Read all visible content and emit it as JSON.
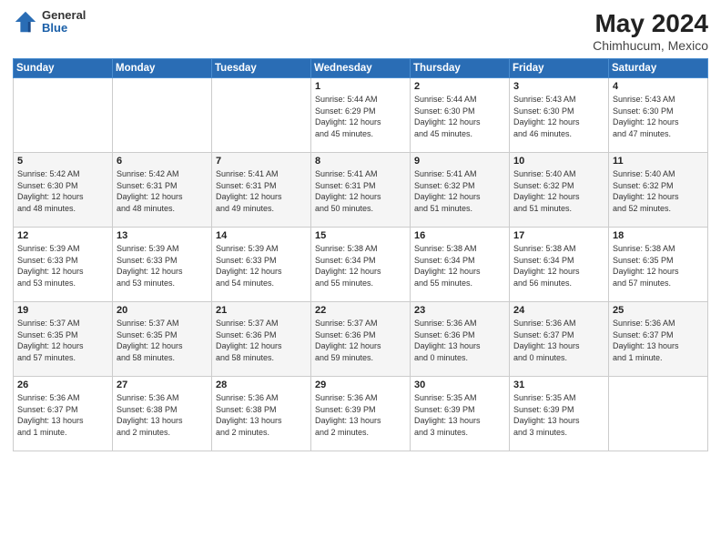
{
  "header": {
    "logo_general": "General",
    "logo_blue": "Blue",
    "month_year": "May 2024",
    "location": "Chimhucum, Mexico"
  },
  "weekdays": [
    "Sunday",
    "Monday",
    "Tuesday",
    "Wednesday",
    "Thursday",
    "Friday",
    "Saturday"
  ],
  "weeks": [
    [
      {
        "day": "",
        "info": ""
      },
      {
        "day": "",
        "info": ""
      },
      {
        "day": "",
        "info": ""
      },
      {
        "day": "1",
        "info": "Sunrise: 5:44 AM\nSunset: 6:29 PM\nDaylight: 12 hours\nand 45 minutes."
      },
      {
        "day": "2",
        "info": "Sunrise: 5:44 AM\nSunset: 6:30 PM\nDaylight: 12 hours\nand 45 minutes."
      },
      {
        "day": "3",
        "info": "Sunrise: 5:43 AM\nSunset: 6:30 PM\nDaylight: 12 hours\nand 46 minutes."
      },
      {
        "day": "4",
        "info": "Sunrise: 5:43 AM\nSunset: 6:30 PM\nDaylight: 12 hours\nand 47 minutes."
      }
    ],
    [
      {
        "day": "5",
        "info": "Sunrise: 5:42 AM\nSunset: 6:30 PM\nDaylight: 12 hours\nand 48 minutes."
      },
      {
        "day": "6",
        "info": "Sunrise: 5:42 AM\nSunset: 6:31 PM\nDaylight: 12 hours\nand 48 minutes."
      },
      {
        "day": "7",
        "info": "Sunrise: 5:41 AM\nSunset: 6:31 PM\nDaylight: 12 hours\nand 49 minutes."
      },
      {
        "day": "8",
        "info": "Sunrise: 5:41 AM\nSunset: 6:31 PM\nDaylight: 12 hours\nand 50 minutes."
      },
      {
        "day": "9",
        "info": "Sunrise: 5:41 AM\nSunset: 6:32 PM\nDaylight: 12 hours\nand 51 minutes."
      },
      {
        "day": "10",
        "info": "Sunrise: 5:40 AM\nSunset: 6:32 PM\nDaylight: 12 hours\nand 51 minutes."
      },
      {
        "day": "11",
        "info": "Sunrise: 5:40 AM\nSunset: 6:32 PM\nDaylight: 12 hours\nand 52 minutes."
      }
    ],
    [
      {
        "day": "12",
        "info": "Sunrise: 5:39 AM\nSunset: 6:33 PM\nDaylight: 12 hours\nand 53 minutes."
      },
      {
        "day": "13",
        "info": "Sunrise: 5:39 AM\nSunset: 6:33 PM\nDaylight: 12 hours\nand 53 minutes."
      },
      {
        "day": "14",
        "info": "Sunrise: 5:39 AM\nSunset: 6:33 PM\nDaylight: 12 hours\nand 54 minutes."
      },
      {
        "day": "15",
        "info": "Sunrise: 5:38 AM\nSunset: 6:34 PM\nDaylight: 12 hours\nand 55 minutes."
      },
      {
        "day": "16",
        "info": "Sunrise: 5:38 AM\nSunset: 6:34 PM\nDaylight: 12 hours\nand 55 minutes."
      },
      {
        "day": "17",
        "info": "Sunrise: 5:38 AM\nSunset: 6:34 PM\nDaylight: 12 hours\nand 56 minutes."
      },
      {
        "day": "18",
        "info": "Sunrise: 5:38 AM\nSunset: 6:35 PM\nDaylight: 12 hours\nand 57 minutes."
      }
    ],
    [
      {
        "day": "19",
        "info": "Sunrise: 5:37 AM\nSunset: 6:35 PM\nDaylight: 12 hours\nand 57 minutes."
      },
      {
        "day": "20",
        "info": "Sunrise: 5:37 AM\nSunset: 6:35 PM\nDaylight: 12 hours\nand 58 minutes."
      },
      {
        "day": "21",
        "info": "Sunrise: 5:37 AM\nSunset: 6:36 PM\nDaylight: 12 hours\nand 58 minutes."
      },
      {
        "day": "22",
        "info": "Sunrise: 5:37 AM\nSunset: 6:36 PM\nDaylight: 12 hours\nand 59 minutes."
      },
      {
        "day": "23",
        "info": "Sunrise: 5:36 AM\nSunset: 6:36 PM\nDaylight: 13 hours\nand 0 minutes."
      },
      {
        "day": "24",
        "info": "Sunrise: 5:36 AM\nSunset: 6:37 PM\nDaylight: 13 hours\nand 0 minutes."
      },
      {
        "day": "25",
        "info": "Sunrise: 5:36 AM\nSunset: 6:37 PM\nDaylight: 13 hours\nand 1 minute."
      }
    ],
    [
      {
        "day": "26",
        "info": "Sunrise: 5:36 AM\nSunset: 6:37 PM\nDaylight: 13 hours\nand 1 minute."
      },
      {
        "day": "27",
        "info": "Sunrise: 5:36 AM\nSunset: 6:38 PM\nDaylight: 13 hours\nand 2 minutes."
      },
      {
        "day": "28",
        "info": "Sunrise: 5:36 AM\nSunset: 6:38 PM\nDaylight: 13 hours\nand 2 minutes."
      },
      {
        "day": "29",
        "info": "Sunrise: 5:36 AM\nSunset: 6:39 PM\nDaylight: 13 hours\nand 2 minutes."
      },
      {
        "day": "30",
        "info": "Sunrise: 5:35 AM\nSunset: 6:39 PM\nDaylight: 13 hours\nand 3 minutes."
      },
      {
        "day": "31",
        "info": "Sunrise: 5:35 AM\nSunset: 6:39 PM\nDaylight: 13 hours\nand 3 minutes."
      },
      {
        "day": "",
        "info": ""
      }
    ]
  ]
}
